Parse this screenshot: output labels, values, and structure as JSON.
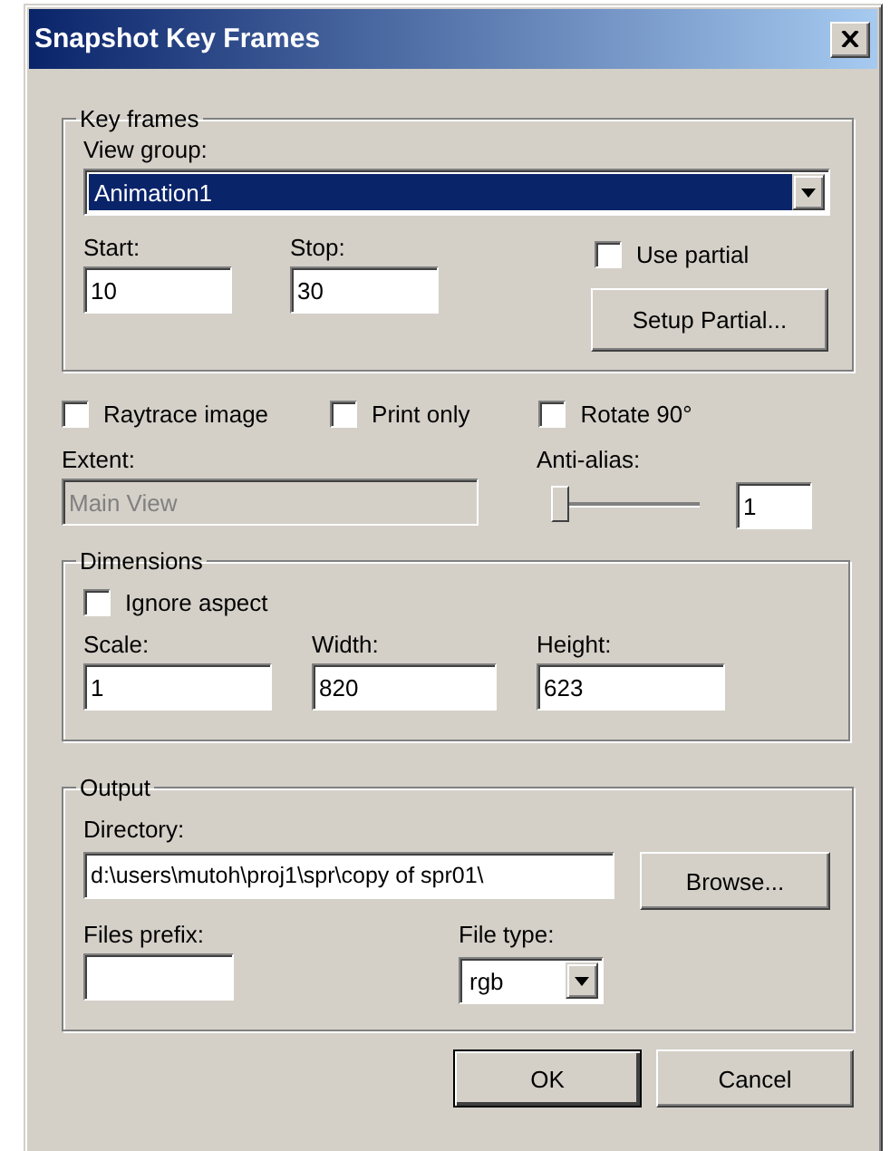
{
  "window": {
    "title": "Snapshot Key Frames"
  },
  "key_frames": {
    "legend": "Key frames",
    "view_group": {
      "label": "View group:",
      "value": "Animation1",
      "focused": true
    },
    "start": {
      "label": "Start:",
      "value": "10"
    },
    "stop": {
      "label": "Stop:",
      "value": "30"
    },
    "use_partial": {
      "label": "Use partial",
      "checked": false
    },
    "setup_button": "Setup Partial..."
  },
  "options": [
    {
      "label": "Raytrace image",
      "checked": false
    },
    {
      "label": "Print only",
      "checked": false
    },
    {
      "label": "Rotate 90°",
      "checked": false
    }
  ],
  "extent": {
    "label": "Extent:",
    "value": "Main View",
    "disabled": true
  },
  "anti_alias": {
    "label": "Anti-alias:",
    "level": 0,
    "value": "1"
  },
  "dimensions": {
    "legend": "Dimensions",
    "ignore_aspect": {
      "label": "Ignore aspect",
      "checked": false
    },
    "fields": [
      {
        "label": "Scale:",
        "value": "1"
      },
      {
        "label": "Width:",
        "value": "820"
      },
      {
        "label": "Height:",
        "value": "623"
      }
    ]
  },
  "output": {
    "legend": "Output",
    "directory": {
      "label": "Directory:",
      "value": "d:\\users\\mutoh\\proj1\\spr\\copy of spr01\\"
    },
    "browse_button": "Browse...",
    "files_prefix": {
      "label": "Files prefix:"
    },
    "file_type": {
      "label": "File type:",
      "value": "rgb"
    }
  },
  "buttons": [
    {
      "label": "OK",
      "default": true
    },
    {
      "label": "Cancel",
      "default": false
    }
  ]
}
